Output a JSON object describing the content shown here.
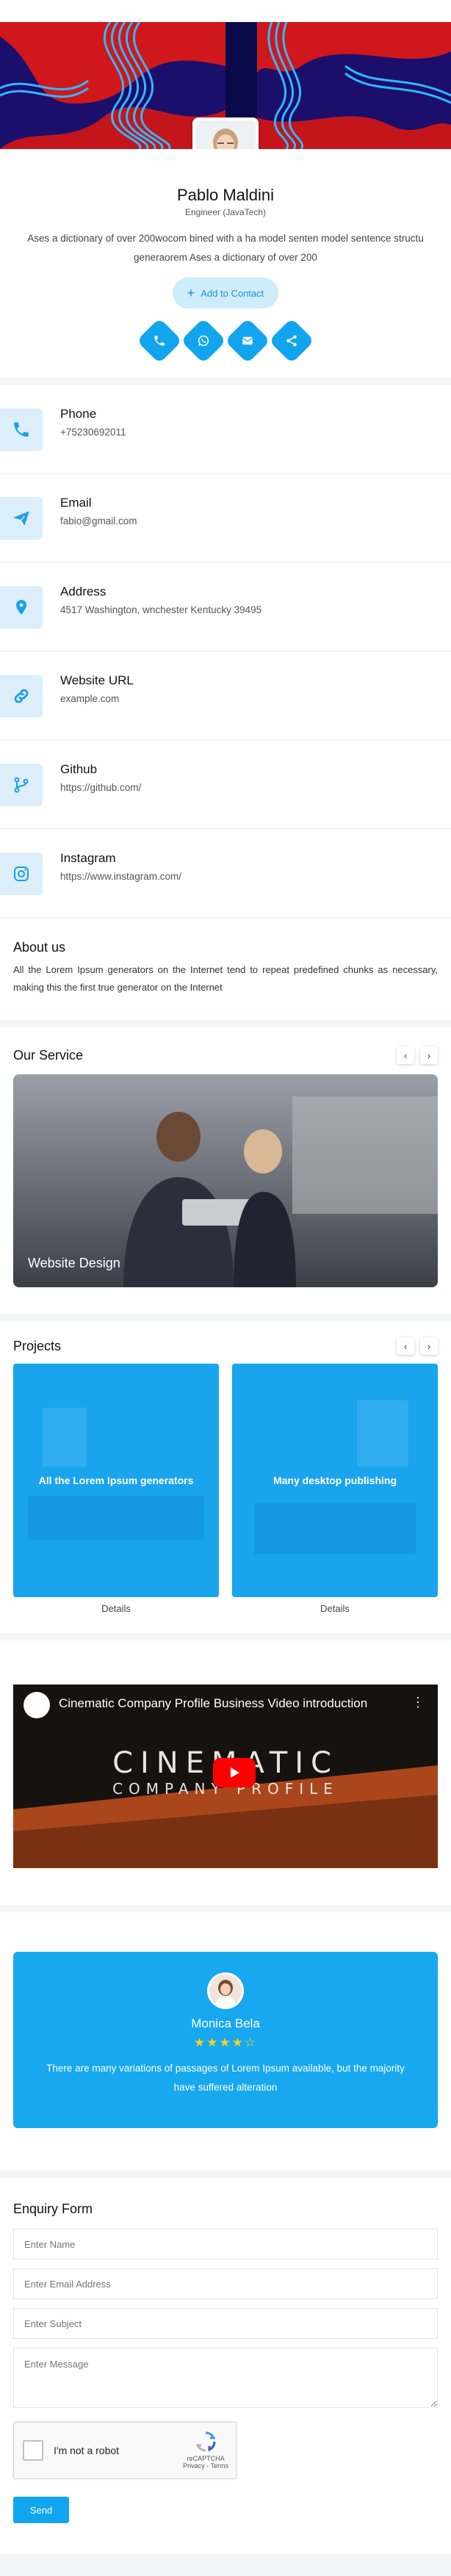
{
  "profile": {
    "name": "Pablo Maldini",
    "role": "Engineer (JavaTech)",
    "bio": "Ases a dictionary of over 200wocom bined with a ha model senten model sentence structu generaorem Ases a dictionary of over 200",
    "add_contact": "Add to Contact",
    "socials": [
      "phone-icon",
      "whatsapp-icon",
      "email-icon",
      "share-icon"
    ]
  },
  "contacts": [
    {
      "label": "Phone",
      "value": "+75230692011",
      "icon": "phone-icon"
    },
    {
      "label": "Email",
      "value": "fabio@gmail.com",
      "icon": "send-icon"
    },
    {
      "label": "Address",
      "value": "4517 Washington, wnchester Kentucky 39495",
      "icon": "location-icon"
    },
    {
      "label": "Website URL",
      "value": "example.com",
      "icon": "link-icon"
    },
    {
      "label": "Github",
      "value": "https://github.com/",
      "icon": "git-branch-icon"
    },
    {
      "label": "Instagram",
      "value": "https://www.instagram.com/",
      "icon": "instagram-icon"
    }
  ],
  "about": {
    "title": "About us",
    "text": "All the Lorem Ipsum generators on the Internet tend to repeat predefined chunks as necessary, making this the first true generator on the Internet"
  },
  "service": {
    "title": "Our Service",
    "prev": "‹",
    "next": "›",
    "card_caption": "Website Design"
  },
  "projects": {
    "title": "Projects",
    "prev": "‹",
    "next": "›",
    "items": [
      {
        "title": "All the Lorem Ipsum generators",
        "link": "Details"
      },
      {
        "title": "Many desktop publishing",
        "link": "Details"
      }
    ]
  },
  "video": {
    "title": "Cinematic Company Profile Business Video introduction",
    "big1": "CINEMATIC",
    "big2": "COMPANY PROFILE"
  },
  "testimonial": {
    "name": "Monica Bela",
    "rating": 4,
    "stars_text": "★★★★☆",
    "text": "There are many variations of passages of Lorem Ipsum available, but the majority have suffered alteration"
  },
  "form": {
    "title": "Enquiry Form",
    "name_ph": "Enter Name",
    "email_ph": "Enter Email Address",
    "subject_ph": "Enter Subject",
    "message_ph": "Enter Message",
    "captcha_label": "I'm not a robot",
    "captcha_brand": "reCAPTCHA",
    "captcha_links": "Privacy - Terms",
    "send": "Send"
  }
}
